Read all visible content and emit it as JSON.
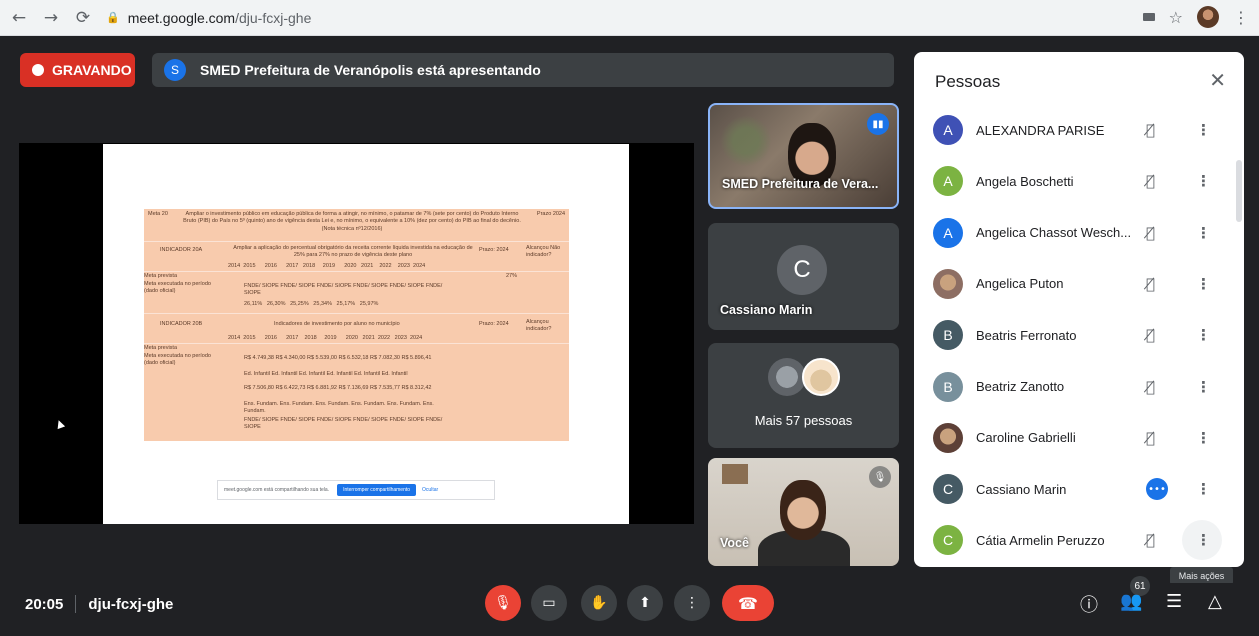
{
  "browser": {
    "url_host": "meet.google.com",
    "url_path": "/dju-fcxj-ghe",
    "icons": [
      "back-icon",
      "forward-icon",
      "reload-icon",
      "lock-icon",
      "camera-icon",
      "star-icon",
      "profile-avatar",
      "menu-icon"
    ]
  },
  "recording": {
    "label": "GRAVANDO"
  },
  "presenting": {
    "initial": "S",
    "text": "SMED Prefeitura de Veranópolis está apresentando"
  },
  "slide": {
    "meta_label": "Meta 20",
    "meta_text": "Ampliar o investimento público em educação pública de forma a atingir, no mínimo, o patamar de 7% (sete por cento) do Produto Interno Bruto (PIB) do País no 5º (quinto) ano de vigência desta Lei e, no mínimo, o equivalente a 10% (dez por cento) do PIB ao final do decênio. (Nota técnica nº12/2016)",
    "prazo": "Prazo 2024",
    "ind20a": "INDICADOR 20A",
    "ind20a_text": "Ampliar a aplicação do percentual obrigatório da receita corrente líquida investida na educação de 25% para 27% no prazo de vigência deste plano",
    "prazo_2024": "Prazo: 2024",
    "alcancou": "Alcançou Não indicador?",
    "years_a": "2014  2015      2016      2017   2018     2019      2020   2021    2022    2023  2024",
    "meta_prevista": "Meta prevista",
    "meta_27": "27%",
    "meta_executada": "Meta executada no período (dado oficial)",
    "fnde_row": "FNDE/ SIOPE   FNDE/ SIOPE   FNDE/ SIOPE   FNDE/ SIOPE   FNDE/ SIOPE   FNDE/ SIOPE",
    "pct_row": "26,11%   26,30%   25,25%   25,34%   25,17%   25,97%",
    "ind20b": "INDICADOR 20B",
    "ind20b_text": "Indicadores de investimento por aluno no município",
    "prazo_2024b": "Prazo: 2024",
    "alcancou_b": "Alcançou indicador?",
    "years_b": "2014  2015      2016      2017    2018     2019      2020   2021  2022   2023  2024",
    "meta_prevista_b": "Meta prevista",
    "meta_executada_b": "Meta executada no período (dado oficial)",
    "rs_row1": "R$ 4.749,38   R$ 4.340,00   R$ 5.539,00   R$ 6.532,18   R$ 7.082,30   R$ 5.896,41",
    "ed_inf": "Ed. Infantil   Ed. Infantil   Ed. Infantil   Ed. Infantil   Ed. Infantil   Ed. Infantil",
    "rs_row2": "R$ 7.506,80   R$ 6.422,73   R$ 6.881,92   R$ 7.136,69   R$ 7.535,77   R$ 8.312,42",
    "ens_fund": "Ens. Fundam.   Ens. Fundam.   Ens. Fundam.   Ens. Fundam.   Ens. Fundam.   Ens. Fundam.",
    "fnde_b": "FNDE/ SIOPE   FNDE/ SIOPE   FNDE/ SIOPE   FNDE/ SIOPE   FNDE/ SIOPE   FNDE/ SIOPE",
    "share_text": "meet.google.com está compartilhando sua tela.",
    "share_stop": "Interromper compartilhamento",
    "share_hide": "Ocultar"
  },
  "tiles": {
    "presenter_name": "SMED Prefeitura de Vera...",
    "cassiano_initial": "C",
    "cassiano_name": "Cassiano Marin",
    "more_people": "Mais 57 pessoas",
    "you_label": "Você"
  },
  "panel": {
    "title": "Pessoas",
    "people": [
      {
        "name": "ALEXANDRA PARISE",
        "initial": "A",
        "color": "#3f51b5",
        "photo": false
      },
      {
        "name": "Angela Boschetti",
        "initial": "A",
        "color": "#7cb342",
        "photo": false
      },
      {
        "name": "Angelica Chassot Wesch...",
        "initial": "A",
        "color": "#1a73e8",
        "photo": false
      },
      {
        "name": "Angelica Puton",
        "initial": "",
        "color": "#8d6e63",
        "photo": true
      },
      {
        "name": "Beatris Ferronato",
        "initial": "B",
        "color": "#455a64",
        "photo": false
      },
      {
        "name": "Beatriz Zanotto",
        "initial": "B",
        "color": "#78909c",
        "photo": false
      },
      {
        "name": "Caroline Gabrielli",
        "initial": "",
        "color": "#5d4037",
        "photo": true
      },
      {
        "name": "Cassiano Marin",
        "initial": "C",
        "color": "#455a64",
        "photo": false,
        "speaking": true
      },
      {
        "name": "Cátia Armelin Peruzzo",
        "initial": "C",
        "color": "#7cb342",
        "photo": false
      }
    ]
  },
  "tooltip": "Mais ações",
  "bottom": {
    "time": "20:05",
    "code": "dju-fcxj-ghe",
    "participant_count": "61"
  }
}
